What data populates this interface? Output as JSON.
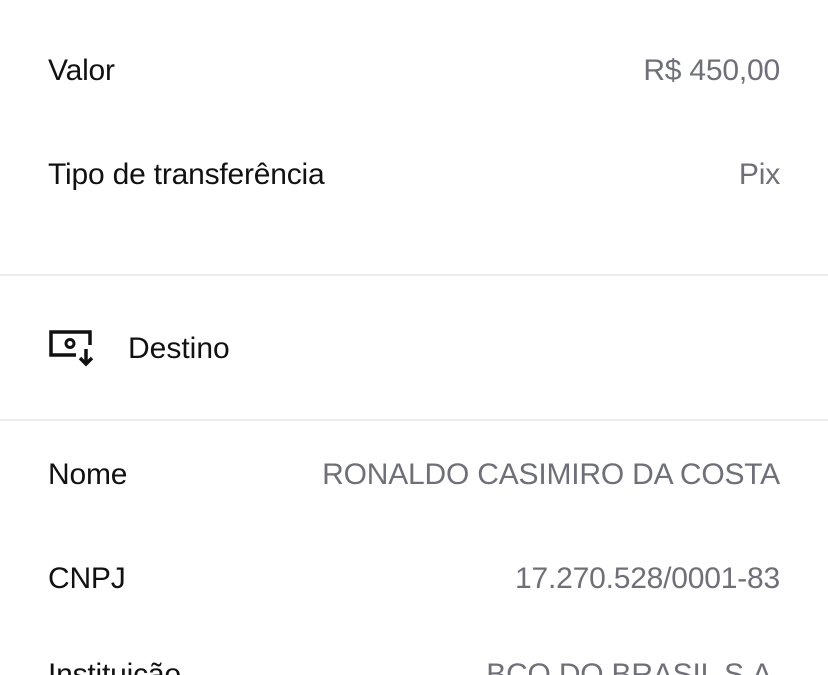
{
  "summary": {
    "rows": [
      {
        "label": "Valor",
        "value": "R$ 450,00"
      },
      {
        "label": "Tipo de transferência",
        "value": "Pix"
      }
    ]
  },
  "destination": {
    "title": "Destino",
    "icon": "receive-money-icon",
    "rows": [
      {
        "label": "Nome",
        "value": "RONALDO CASIMIRO DA COSTA"
      },
      {
        "label": "CNPJ",
        "value": "17.270.528/0001-83"
      },
      {
        "label": "Instituição",
        "value": "BCO DO BRASIL S.A."
      }
    ]
  },
  "colors": {
    "label": "#111111",
    "value": "#6f6f7a",
    "divider": "#ececee"
  }
}
